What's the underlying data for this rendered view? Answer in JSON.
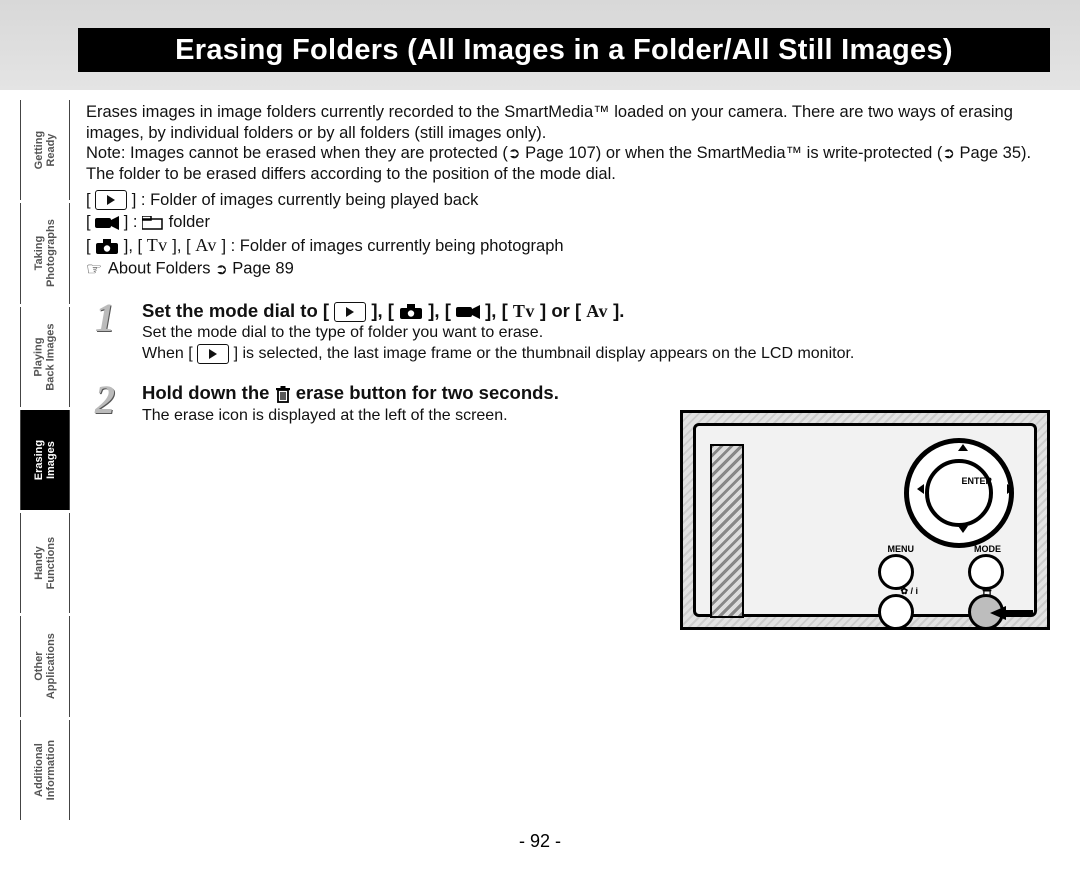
{
  "title": "Erasing Folders (All Images in a Folder/All Still Images)",
  "sidebar": {
    "items": [
      {
        "label": "Getting\nReady"
      },
      {
        "label": "Taking\nPhotographs"
      },
      {
        "label": "Playing\nBack Images"
      },
      {
        "label": "Erasing\nImages"
      },
      {
        "label": "Handy\nFunctions"
      },
      {
        "label": "Other\nApplications"
      },
      {
        "label": "Additional\nInformation"
      }
    ],
    "selected_index": 3
  },
  "intro": {
    "p1": "Erases images in image folders currently recorded to the SmartMedia™ loaded on your camera. There are two ways of erasing images, by individual folders or by all folders (still images only).",
    "note_prefix": "Note: Images cannot be erased when they are protected (",
    "note_ref1": "Page 107",
    "note_mid": ") or when the SmartMedia™ is write-protected (",
    "note_ref2": "Page 35",
    "note_suffix": ").",
    "p3": "The folder to be erased differs according to the position of the mode dial."
  },
  "mode_lines": {
    "play": " : Folder of images currently being played back",
    "movie": " folder",
    "cam": " : Folder of images currently being photograph",
    "about_prefix": " About Folders ",
    "about_ref": "Page 89"
  },
  "steps": [
    {
      "num": "1",
      "head_prefix": "Set the mode dial to [ ",
      "head_mid1": " ], [ ",
      "head_mid2": " ], [ ",
      "head_mid3": " ], [ ",
      "tv": "Tv",
      "head_mid4": " ] or [ ",
      "av": "Av",
      "head_suffix": " ].",
      "sub1": "Set the mode dial to the type of folder you want to erase.",
      "sub2_prefix": "When [ ",
      "sub2_suffix": " ] is selected, the last image frame or the thumbnail display appears on the LCD monitor."
    },
    {
      "num": "2",
      "head_prefix": "Hold down the ",
      "head_suffix": " erase button for two seconds.",
      "sub1": "The erase icon is displayed at the left of the screen."
    }
  ],
  "illus": {
    "enter": "ENTER",
    "menu": "MENU",
    "mode": "MODE",
    "left_label": "✿ / i",
    "trash_label": "🗑"
  },
  "page_number": "- 92 -"
}
